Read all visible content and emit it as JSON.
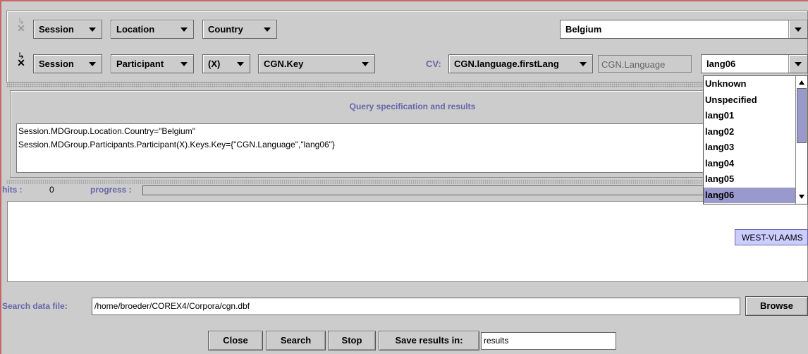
{
  "row1": {
    "combo1": "Session",
    "combo2": "Location",
    "combo3": "Country",
    "value": "Belgium"
  },
  "row2": {
    "combo1": "Session",
    "combo2": "Participant",
    "combo3": "(X)",
    "combo4": "CGN.Key",
    "cv_label": "CV:",
    "cv_combo": "CGN.language.firstLang",
    "cv_field": "CGN.Language",
    "value": "lang06"
  },
  "dropdown": {
    "items": [
      "Unknown",
      "Unspecified",
      "lang01",
      "lang02",
      "lang03",
      "lang04",
      "lang05",
      "lang06"
    ],
    "selected": "lang06"
  },
  "query": {
    "title": "Query specification and results",
    "lines": [
      "Session.MDGroup.Location.Country=\"Belgium\"",
      "Session.MDGroup.Participants.Participant(X).Keys.Key={\"CGN.Language\",\"lang06\"}"
    ]
  },
  "status": {
    "hits_label": "hits :",
    "hits_value": "0",
    "progress_label": "progress :",
    "progress": 0
  },
  "tooltip": "WEST-VLAAMS",
  "search_file": {
    "label": "Search data file:",
    "value": "/home/broeder/COREX4/Corpora/cgn.dbf",
    "browse": "Browse"
  },
  "buttons": {
    "close": "Close",
    "search": "Search",
    "stop": "Stop",
    "save": "Save results in:",
    "save_field": "results"
  },
  "colors": {
    "background": "#cccccc",
    "frame": "#cc6666",
    "accent_text": "#6666aa",
    "selection": "#9999cc"
  }
}
